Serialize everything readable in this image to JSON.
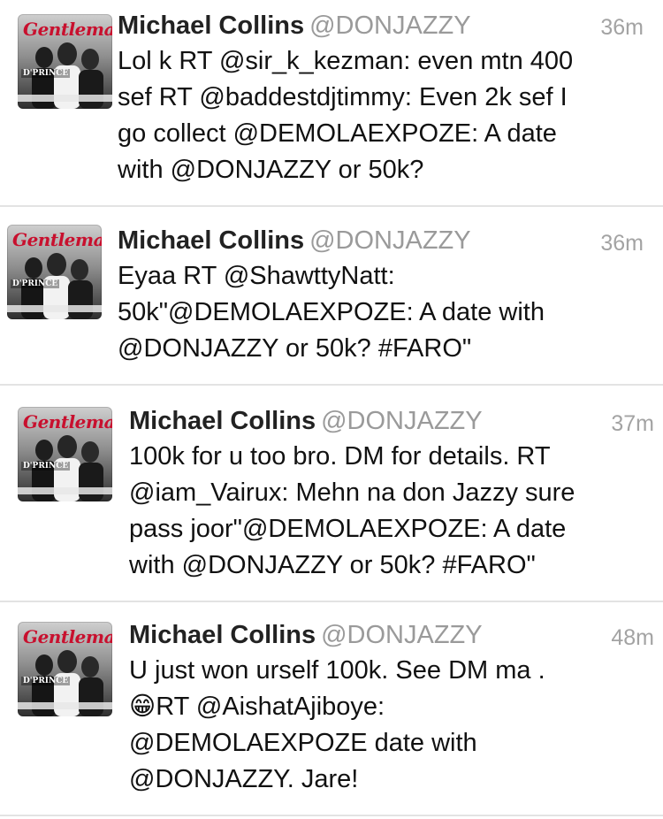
{
  "tweets": [
    {
      "author": "Michael Collins",
      "handle": "@DONJAZZY",
      "time": "36m",
      "lines": [
        "Lol k RT @sir_k_kezman: even mtn 400",
        "sef RT @baddestdjtimmy: Even 2k sef I",
        "go collect @DEMOLAEXPOZE: A date",
        "with @DONJAZZY or 50k?"
      ],
      "avatar": {
        "brand": "Gentleman",
        "label": "D'PRINCE"
      }
    },
    {
      "author": "Michael Collins",
      "handle": "@DONJAZZY",
      "time": "36m",
      "lines": [
        "Eyaa RT @ShawttyNatt:",
        "50k\"@DEMOLAEXPOZE: A date with",
        "@DONJAZZY or 50k? #FARO\""
      ],
      "avatar": {
        "brand": "Gentleman",
        "label": "D'PRINCE"
      }
    },
    {
      "author": "Michael Collins",
      "handle": "@DONJAZZY",
      "time": "37m",
      "lines": [
        "100k for u too bro. DM for details. RT",
        "@iam_Vairux: Mehn na don Jazzy sure",
        "pass joor\"@DEMOLAEXPOZE: A date",
        "with @DONJAZZY or 50k? #FARO\""
      ],
      "avatar": {
        "brand": "Gentleman",
        "label": "D'PRINCE"
      }
    },
    {
      "author": "Michael Collins",
      "handle": "@DONJAZZY",
      "time": "48m",
      "lines": [
        "U just won urself 100k. See DM ma .",
        "😁RT @AishatAjiboye:",
        "@DEMOLAEXPOZE date with",
        "@DONJAZZY. Jare!"
      ],
      "avatar": {
        "brand": "Gentleman",
        "label": "D'PRINCE"
      }
    }
  ],
  "colors": {
    "name": "#222222",
    "handle": "#9a9a9a",
    "time": "#a3a3a3",
    "divider": "#e3e3e3",
    "brand": "#c8102e"
  }
}
